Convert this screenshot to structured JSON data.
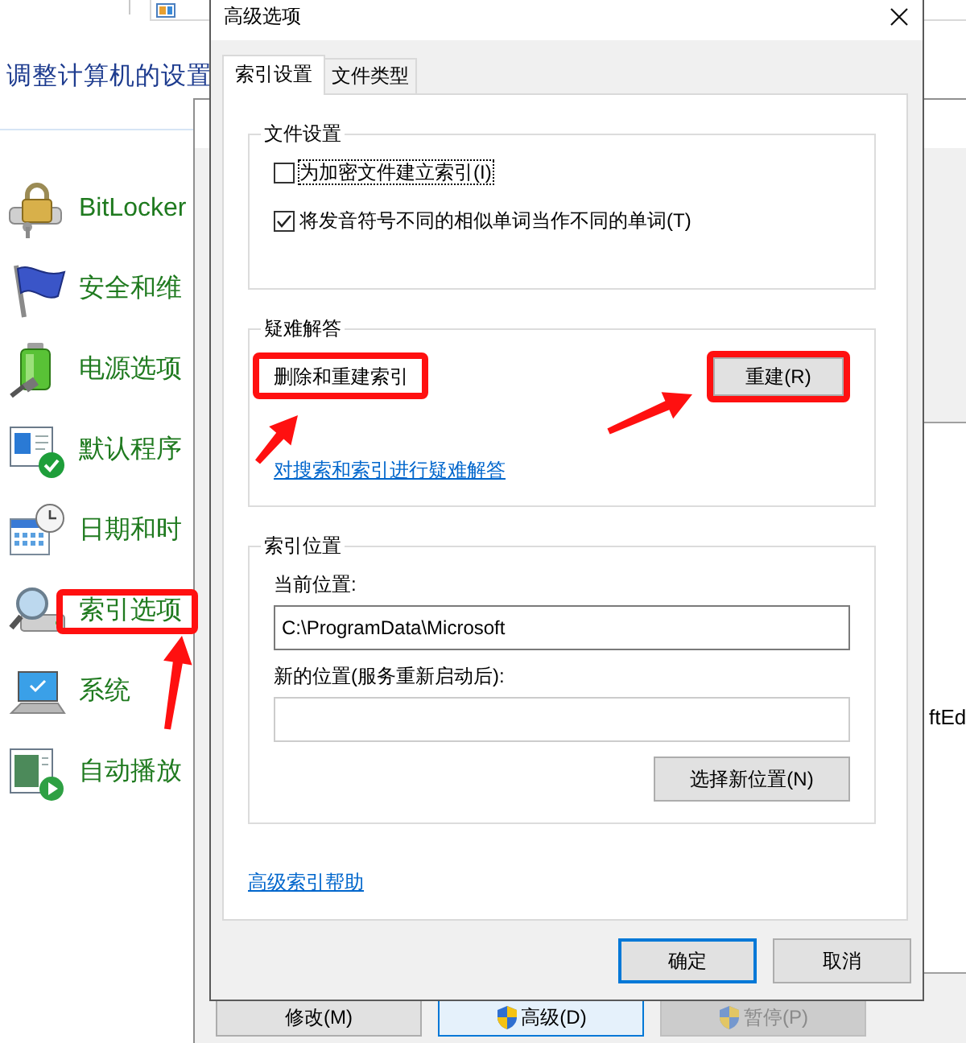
{
  "control_panel": {
    "title": "调整计算机的设置",
    "items": [
      {
        "label": "BitLocker",
        "annotated": false
      },
      {
        "label": "安全和维",
        "annotated": false
      },
      {
        "label": "电源选项",
        "annotated": false
      },
      {
        "label": "默认程序",
        "annotated": false
      },
      {
        "label": "日期和时",
        "annotated": false
      },
      {
        "label": "索引选项",
        "annotated": true
      },
      {
        "label": "系统",
        "annotated": false
      },
      {
        "label": "自动播放",
        "annotated": false
      }
    ]
  },
  "indexing_window": {
    "list_cell": "ftEd",
    "buttons": [
      {
        "label": "修改(M)",
        "kind": "plain",
        "highlighted": false,
        "disabled": false
      },
      {
        "label": "高级(D)",
        "kind": "elevated",
        "highlighted": true,
        "disabled": false
      },
      {
        "label": "暂停(P)",
        "kind": "elevated",
        "highlighted": false,
        "disabled": true
      }
    ]
  },
  "dialog": {
    "title": "高级选项",
    "tabs": [
      {
        "label": "索引设置",
        "selected": true
      },
      {
        "label": "文件类型",
        "selected": false
      }
    ],
    "file_settings": {
      "legend": "文件设置",
      "checkboxes": [
        {
          "label": "为加密文件建立索引(I)",
          "checked": false,
          "focused": true
        },
        {
          "label": "将发音符号不同的相似单词当作不同的单词(T)",
          "checked": true,
          "focused": false
        }
      ]
    },
    "troubleshooting": {
      "legend": "疑难解答",
      "rebuild_text": {
        "text": "删除和重建索引",
        "annotated": true
      },
      "rebuild_button": {
        "label": "重建(R)",
        "annotated": true
      },
      "link": "对搜索和索引进行疑难解答"
    },
    "index_location": {
      "legend": "索引位置",
      "current_label": "当前位置:",
      "current_value": "C:\\ProgramData\\Microsoft",
      "new_label": "新的位置(服务重新启动后):",
      "select_button": "选择新位置(N)"
    },
    "help_link": "高级索引帮助",
    "buttons": [
      {
        "label": "确定",
        "default": true
      },
      {
        "label": "取消",
        "default": false
      }
    ]
  }
}
